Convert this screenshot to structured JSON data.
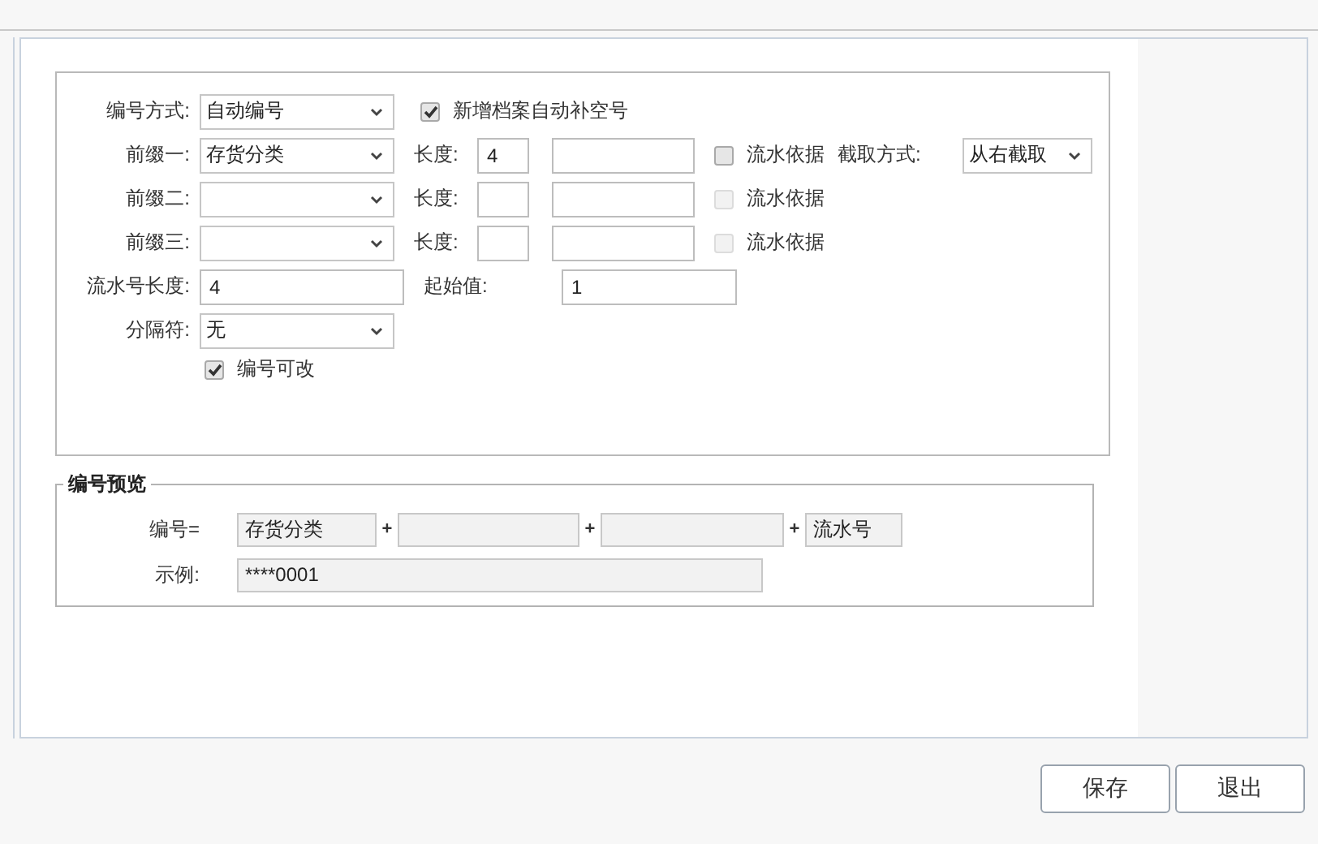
{
  "numbering": {
    "label": "编号方式:",
    "value": "自动编号"
  },
  "auto_fill": {
    "label": "新增档案自动补空号",
    "checked": true
  },
  "prefixes": [
    {
      "label": "前缀一:",
      "value": "存货分类",
      "length_label": "长度:",
      "length": "4",
      "serial_basis": {
        "label": "流水依据",
        "checked": false,
        "disabled": false
      }
    },
    {
      "label": "前缀二:",
      "length_label": "长度:",
      "serial_basis": {
        "label": "流水依据",
        "checked": false,
        "disabled": true
      }
    },
    {
      "label": "前缀三:",
      "length_label": "长度:",
      "serial_basis": {
        "label": "流水依据",
        "checked": false,
        "disabled": true
      }
    }
  ],
  "cut_mode": {
    "label": "截取方式:",
    "value": "从右截取"
  },
  "serial_length": {
    "label": "流水号长度:",
    "value": "4"
  },
  "start": {
    "label": "起始值:",
    "value": "1"
  },
  "separator": {
    "label": "分隔符:",
    "value": "无"
  },
  "editable": {
    "label": "编号可改",
    "checked": true
  },
  "preview": {
    "title": "编号预览",
    "code_label": "编号=",
    "parts": [
      {
        "value": "存货分类"
      },
      {
        "joiner": "+"
      },
      {
        "joiner": "+"
      },
      {
        "joiner": "+",
        "value": "流水号"
      }
    ],
    "example_label": "示例:",
    "example": "****0001"
  },
  "buttons": [
    "保存",
    "退出"
  ]
}
